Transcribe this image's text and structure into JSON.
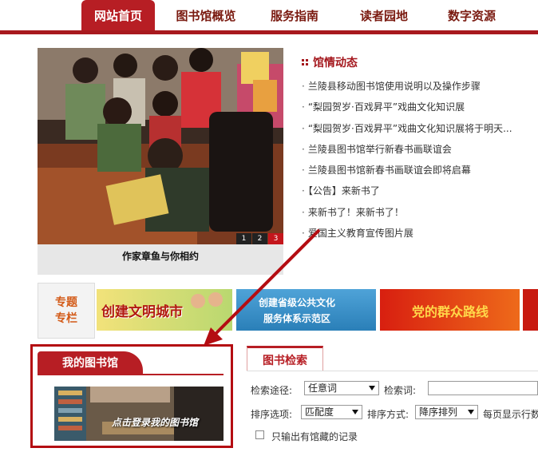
{
  "nav": {
    "items": [
      {
        "label": "网站首页",
        "active": true
      },
      {
        "label": "图书馆概览",
        "active": false
      },
      {
        "label": "服务指南",
        "active": false
      },
      {
        "label": "读者园地",
        "active": false
      },
      {
        "label": "数字资源",
        "active": false
      }
    ]
  },
  "slideshow": {
    "caption": "作家章鱼与你相约",
    "pages": [
      "1",
      "2",
      "3"
    ],
    "current_page": "3"
  },
  "news": {
    "title": "馆情动态",
    "items": [
      "兰陵县移动图书馆使用说明以及操作步骤",
      "“梨园贺岁·百戏昇平”戏曲文化知识展",
      "“梨园贺岁·百戏昇平”戏曲文化知识展将于明天...",
      "兰陵县图书馆举行新春书画联谊会",
      "兰陵县图书馆新春书画联谊会即将启幕",
      "【公告】来新书了",
      "来新书了！来新书了！",
      "爱国主义教育宣传图片展"
    ]
  },
  "special": {
    "label_line1": "专题",
    "label_line2": "专栏",
    "banners": [
      {
        "text": "创建文明城市"
      },
      {
        "text_line1": "创建省级公共文化",
        "text_line2": "服务体系示范区"
      },
      {
        "text": "党的群众路线"
      }
    ]
  },
  "mylibrary": {
    "tab": "我的图书馆",
    "login_text": "点击登录我的图书馆"
  },
  "search": {
    "tab": "图书检索",
    "path_label": "检索途径:",
    "path_value": "任意词",
    "keyword_label": "检索词:",
    "sort_option_label": "排序选项:",
    "sort_option_value": "匹配度",
    "sort_method_label": "排序方式:",
    "sort_method_value": "降序排列",
    "per_page_label": "每页显示行数",
    "holdings_only_label": "只输出有馆藏的记录"
  },
  "colors": {
    "brand_red": "#b71e24",
    "highlight_red": "#b40d12"
  }
}
